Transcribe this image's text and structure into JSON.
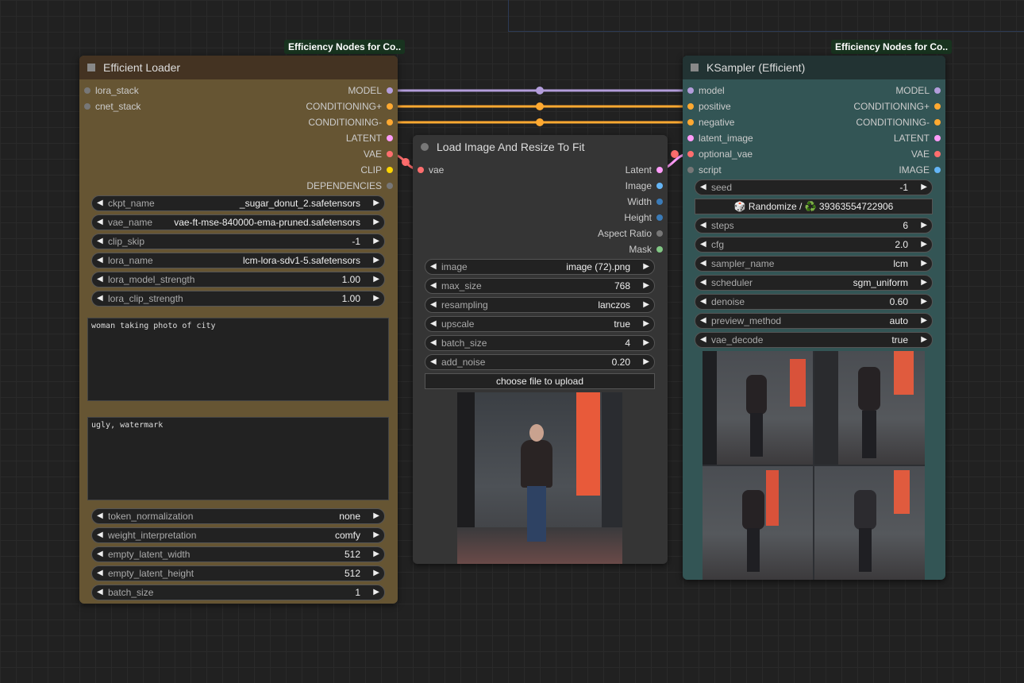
{
  "colors": {
    "canvas": "#212121",
    "loader_body": "#665533",
    "loader_head": "#443322",
    "ksampler_body": "#335555",
    "ksampler_head": "#223333",
    "resize_body": "#353535",
    "wire_model": "#b39ddb",
    "wire_conditioning": "#ffa931",
    "wire_vae": "#ff6e6e"
  },
  "badges": {
    "loader": "Efficiency Nodes for Co..",
    "ksampler": "Efficiency Nodes for Co.."
  },
  "loader": {
    "title": "Efficient Loader",
    "inputs": [
      "lora_stack",
      "cnet_stack"
    ],
    "outputs": [
      "MODEL",
      "CONDITIONING+",
      "CONDITIONING-",
      "LATENT",
      "VAE",
      "CLIP",
      "DEPENDENCIES"
    ],
    "widgets": [
      {
        "label": "ckpt_name",
        "value": "_sugar_donut_2.safetensors"
      },
      {
        "label": "vae_name",
        "value": "vae-ft-mse-840000-ema-pruned.safetensors"
      },
      {
        "label": "clip_skip",
        "value": "-1"
      },
      {
        "label": "lora_name",
        "value": "lcm-lora-sdv1-5.safetensors"
      },
      {
        "label": "lora_model_strength",
        "value": "1.00"
      },
      {
        "label": "lora_clip_strength",
        "value": "1.00"
      }
    ],
    "positive_prompt": "woman taking photo of city",
    "negative_prompt": "ugly, watermark",
    "widgets2": [
      {
        "label": "token_normalization",
        "value": "none"
      },
      {
        "label": "weight_interpretation",
        "value": "comfy"
      },
      {
        "label": "empty_latent_width",
        "value": "512"
      },
      {
        "label": "empty_latent_height",
        "value": "512"
      },
      {
        "label": "batch_size",
        "value": "1"
      }
    ]
  },
  "resize": {
    "title": "Load Image And Resize To Fit",
    "inputs": [
      "vae"
    ],
    "outputs": [
      "Latent",
      "Image",
      "Width",
      "Height",
      "Aspect Ratio",
      "Mask"
    ],
    "widgets": [
      {
        "label": "image",
        "value": "image (72).png"
      },
      {
        "label": "max_size",
        "value": "768"
      },
      {
        "label": "resampling",
        "value": "lanczos"
      },
      {
        "label": "upscale",
        "value": "true"
      },
      {
        "label": "batch_size",
        "value": "4"
      },
      {
        "label": "add_noise",
        "value": "0.20"
      }
    ],
    "upload_label": "choose file to upload"
  },
  "ksampler": {
    "title": "KSampler (Efficient)",
    "inputs": [
      "model",
      "positive",
      "negative",
      "latent_image",
      "optional_vae",
      "script"
    ],
    "outputs": [
      "MODEL",
      "CONDITIONING+",
      "CONDITIONING-",
      "LATENT",
      "VAE",
      "IMAGE"
    ],
    "seed": {
      "label": "seed",
      "value": "-1"
    },
    "randomize_label": "🎲 Randomize / ♻️ 39363554722906",
    "widgets": [
      {
        "label": "steps",
        "value": "6"
      },
      {
        "label": "cfg",
        "value": "2.0"
      },
      {
        "label": "sampler_name",
        "value": "lcm"
      },
      {
        "label": "scheduler",
        "value": "sgm_uniform"
      },
      {
        "label": "denoise",
        "value": "0.60"
      },
      {
        "label": "preview_method",
        "value": "auto"
      },
      {
        "label": "vae_decode",
        "value": "true"
      }
    ]
  },
  "arrows": {
    "left": "◀",
    "right": "▶"
  }
}
